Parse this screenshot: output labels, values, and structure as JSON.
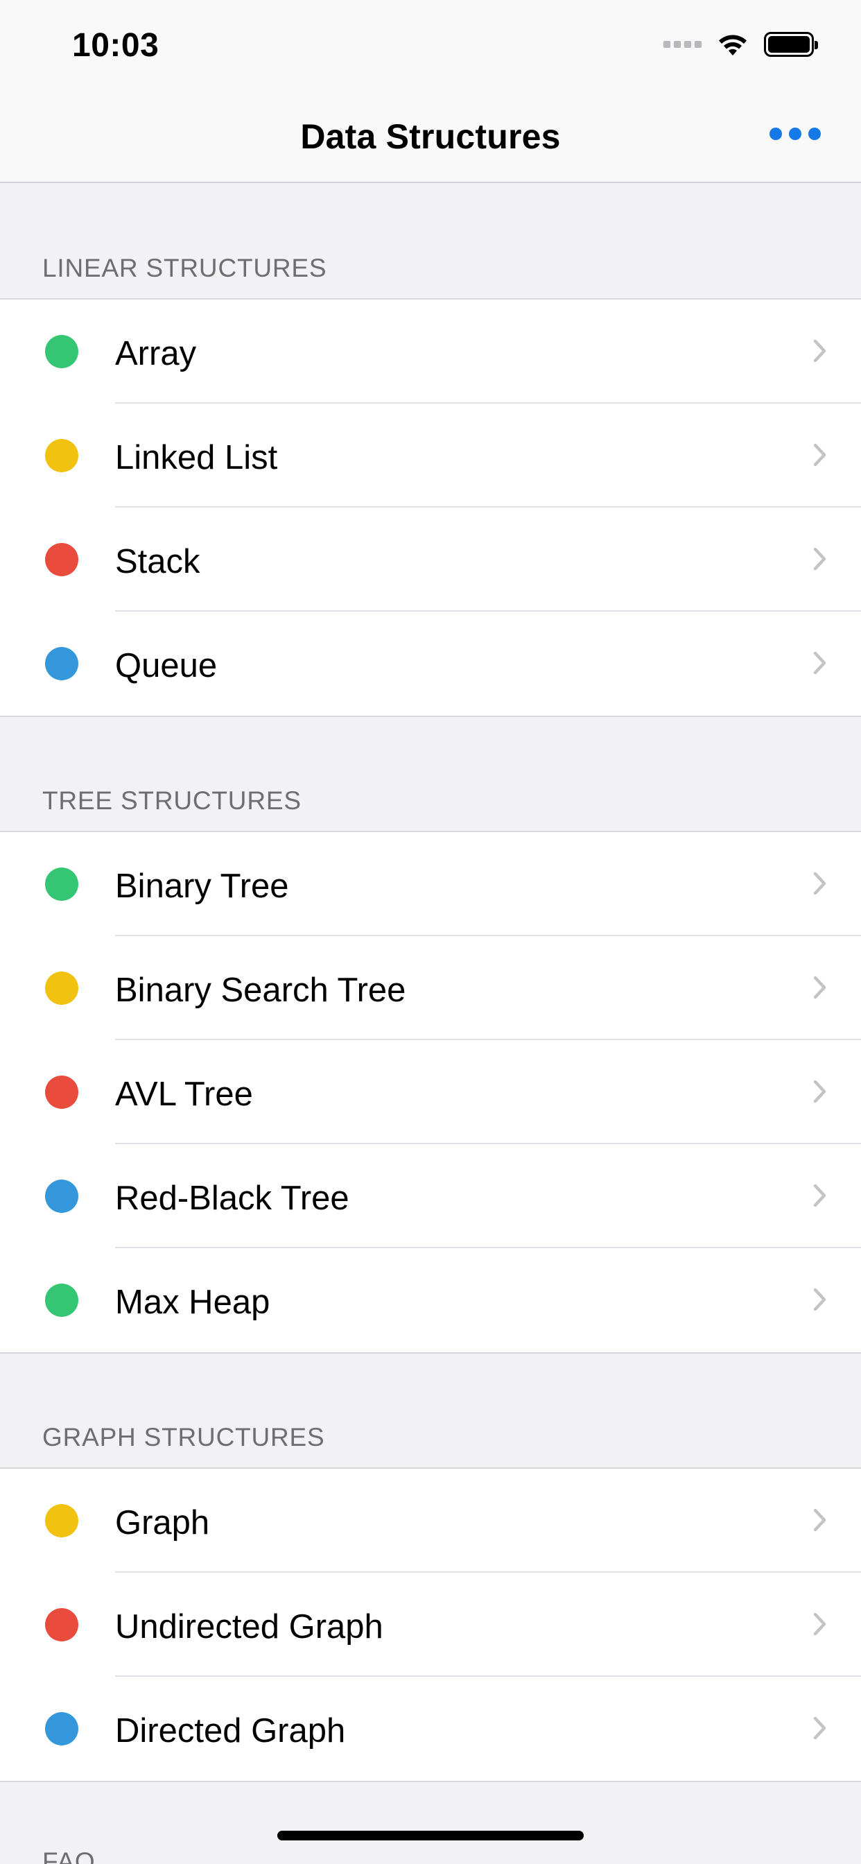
{
  "status_bar": {
    "time": "10:03"
  },
  "nav": {
    "title": "Data Structures",
    "more_icon": "more-dots-icon"
  },
  "colors": {
    "green": "#34c672",
    "yellow": "#f1c20f",
    "red": "#e94c3d",
    "blue": "#3497db",
    "accent": "#1679e8"
  },
  "sections": [
    {
      "header": "LINEAR STRUCTURES",
      "items": [
        {
          "label": "Array",
          "color": "#34c672"
        },
        {
          "label": "Linked List",
          "color": "#f1c20f"
        },
        {
          "label": "Stack",
          "color": "#e94c3d"
        },
        {
          "label": "Queue",
          "color": "#3497db"
        }
      ]
    },
    {
      "header": "TREE STRUCTURES",
      "items": [
        {
          "label": "Binary Tree",
          "color": "#34c672"
        },
        {
          "label": "Binary Search Tree",
          "color": "#f1c20f"
        },
        {
          "label": "AVL Tree",
          "color": "#e94c3d"
        },
        {
          "label": "Red-Black Tree",
          "color": "#3497db"
        },
        {
          "label": "Max Heap",
          "color": "#34c672"
        }
      ]
    },
    {
      "header": "GRAPH STRUCTURES",
      "items": [
        {
          "label": "Graph",
          "color": "#f1c20f"
        },
        {
          "label": "Undirected Graph",
          "color": "#e94c3d"
        },
        {
          "label": "Directed Graph",
          "color": "#3497db"
        }
      ]
    }
  ],
  "faq": {
    "header": "FAQ"
  }
}
